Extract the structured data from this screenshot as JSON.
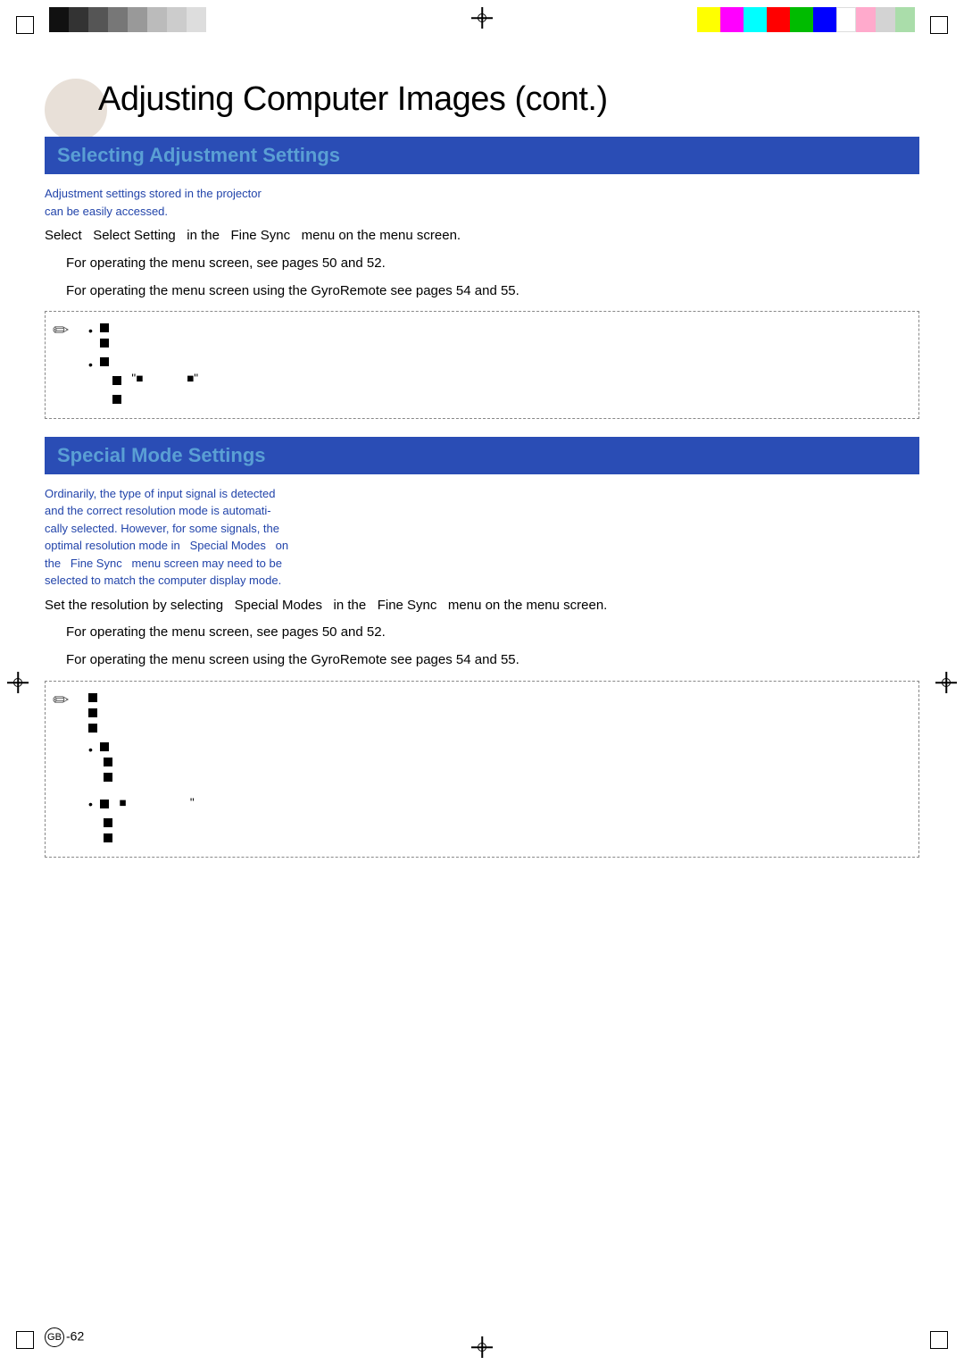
{
  "page": {
    "title": "Adjusting Computer Images (cont.)",
    "page_number": "GB-62",
    "gb_label": "GB"
  },
  "section1": {
    "header": "Selecting Adjustment Settings",
    "subtitle": "Adjustment settings stored in the projector\ncan be easily accessed.",
    "body1": "Select  Select Setting   in the  Fine Sync  menu on the menu screen.",
    "body2": "For operating the menu screen, see pages 50 and 52.",
    "body3": "For operating the menu screen using the GyroRemote see pages 54 and 55.",
    "note_items": [
      {
        "bullet": true,
        "lines": [
          "■",
          "■"
        ]
      },
      {
        "bullet": true,
        "lines": [
          "■",
          "■  \"■             ■\"",
          "■"
        ]
      }
    ]
  },
  "section2": {
    "header": "Special Mode Settings",
    "subtitle": "Ordinarily, the type of input signal is detected\nand the correct resolution mode is automati-\ncally selected. However, for some signals, the\noptimal resolution mode in   Special Modes  on\nthe  Fine Sync  menu screen may need to be\nselected to match the computer display mode.",
    "body1": "Set the resolution by selecting   Special Modes  in the  Fine Sync  menu on the menu screen.",
    "body2": "For operating the menu screen, see pages 50 and 52.",
    "body3": "For operating the menu screen using the GyroRemote see pages 54 and 55.",
    "note_items": [
      {
        "line": "■"
      },
      {
        "line": "■"
      },
      {
        "line": "■"
      },
      {
        "bullet": true,
        "line": "■"
      },
      {
        "line": "■"
      },
      {
        "line": "■"
      },
      {
        "bullet": true,
        "line": "■             \""
      },
      {
        "line": "■"
      },
      {
        "line": "■"
      }
    ]
  },
  "colors": {
    "left_bars": [
      "#1a1a1a",
      "#333",
      "#555",
      "#777",
      "#999",
      "#bbb",
      "#ddd",
      "#eee"
    ],
    "right_bars": [
      "#ffff00",
      "#ff00ff",
      "#00ffff",
      "#ff0000",
      "#00ff00",
      "#0000ff",
      "#ffffff",
      "#ff69b4",
      "#d3d3d3",
      "#90ee90"
    ]
  }
}
